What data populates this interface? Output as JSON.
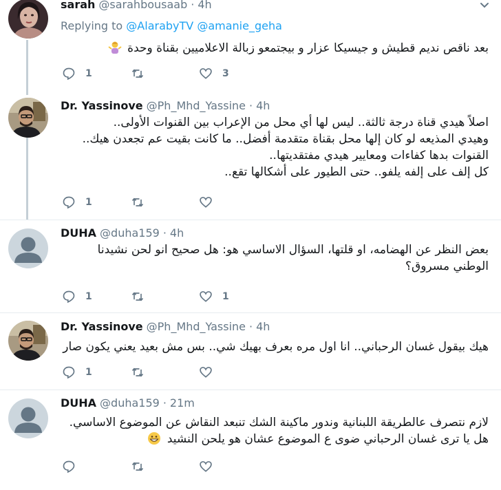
{
  "tweets": [
    {
      "name": "sarah",
      "handle": "@sarahbousaab",
      "dot": "·",
      "time": "4h",
      "replying_prefix": "Replying to",
      "replying_to": [
        "@AlarabyTV",
        "@amanie_geha"
      ],
      "lines": [
        "بعد ناقص نديم قطيش و جيسيكا عزار و بيجتمعو زبالة الاعلاميين بقناة وحدة"
      ],
      "reply_count": "1",
      "retweet_count": "",
      "like_count": "3",
      "avatar": "photo-woman"
    },
    {
      "name": "Dr. Yassinove",
      "handle": "@Ph_Mhd_Yassine",
      "dot": "·",
      "time": "4h",
      "lines": [
        "اصلاً هيدي قناة درجة ثالثة.. ليس لها أي محل من الإعراب بين القنوات الأولى..",
        "وهيدي المذيعه لو كان إلها محل بقناة متقدمة أفضل.. ما كانت بقيت عم تجعدن هيك..",
        "القنوات بدها كفاءات ومعايير هيدي مفتقديتها..",
        "كل إلف على إلفه يلفو.. حتى الطيور على أشكالها تقع.."
      ],
      "reply_count": "1",
      "retweet_count": "",
      "like_count": "",
      "avatar": "photo-man"
    },
    {
      "name": "DUHA",
      "handle": "@duha159",
      "dot": "·",
      "time": "4h",
      "lines": [
        "بعض النظر عن الهضامه، او قلتها، السؤال الاساسي هو: هل صحيح انو لحن نشيدنا",
        "الوطني مسروق؟"
      ],
      "reply_count": "1",
      "retweet_count": "",
      "like_count": "1",
      "avatar": "default"
    },
    {
      "name": "Dr. Yassinove",
      "handle": "@Ph_Mhd_Yassine",
      "dot": "·",
      "time": "4h",
      "lines": [
        "هيك بيقول غسان الرحباني.. انا اول مره بعرف بهيك شي.. بس مش بعيد يعني يكون صار"
      ],
      "reply_count": "1",
      "retweet_count": "",
      "like_count": "",
      "avatar": "photo-man"
    },
    {
      "name": "DUHA",
      "handle": "@duha159",
      "dot": "·",
      "time": "21m",
      "lines": [
        "لازم نتصرف عالطريقة اللبنانية وندور ماكينة الشك تنبعد النقاش عن الموضوع الاساسي.",
        "هل يا ترى غسان الرحباني ضوى ع الموضوع عشان هو يلحن النشيد"
      ],
      "reply_count": "",
      "retweet_count": "",
      "like_count": "",
      "avatar": "default"
    }
  ],
  "colors": {
    "link": "#1da1f2",
    "meta": "#657786",
    "text": "#14171a",
    "thread_line": "#c4cfd6",
    "separator": "#e6ecf0"
  }
}
